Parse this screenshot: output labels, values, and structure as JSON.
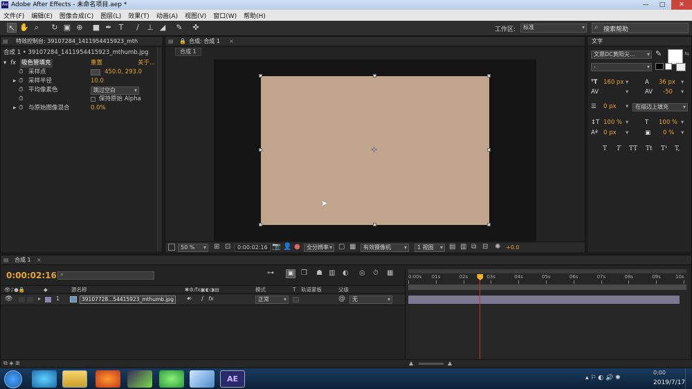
{
  "window": {
    "title": "Adobe After Effects - 未命名项目.aep *",
    "app_badge": "Ae",
    "controls": [
      "—",
      "□",
      "✕"
    ]
  },
  "menu": [
    "文件(F)",
    "编辑(E)",
    "图像合成(C)",
    "图层(L)",
    "效果(T)",
    "动画(A)",
    "视图(V)",
    "窗口(W)",
    "帮助(H)"
  ],
  "toolbar": {
    "workspace_label": "工作区:",
    "workspace_value": "标准",
    "search_placeholder": "搜索帮助"
  },
  "effects_panel": {
    "tab_label": "特效控制台: 39107284_1411954415923_mth",
    "breadcrumb": "合成 1 • 39107284_1411954415923_mthumb.jpg",
    "fx_badge": "fx",
    "effect_name": "吸色管填充",
    "reset": "重置",
    "about": "关于...",
    "props": [
      {
        "label": "采样点",
        "value": "450.0, 293.0"
      },
      {
        "label": "采样半径",
        "value": "10.0"
      },
      {
        "label": "平均像素色",
        "value": "跳过空白"
      },
      {
        "label": "保持原始 Alpha",
        "value": ""
      },
      {
        "label": "与原始图像混合",
        "value": "0.0%"
      }
    ]
  },
  "comp_panel": {
    "tab_label": "合成: 合成 1",
    "subtab": "合成 1",
    "layer_color": "#c0a48c",
    "bottom": {
      "zoom": "50 %",
      "timecode": "0:00:02:16",
      "resolution": "全分辨率",
      "camera": "有效摄像机",
      "views": "1 视图",
      "exposure": "+0.0"
    }
  },
  "character_panel": {
    "tab_label": "文字",
    "font": "文鼎DC黄阳尖...",
    "style": "-",
    "size": "160 px",
    "leading": "36 px",
    "kerning": "",
    "tracking": "-50",
    "stroke_width": "0 px",
    "stroke_mode": "在描边上填充",
    "vscale": "100 %",
    "hscale": "100 %",
    "baseline": "0 px",
    "tsume": "0 %",
    "styles": [
      "T",
      "T",
      "TT",
      "Tt",
      "T¹",
      "T,"
    ]
  },
  "timeline": {
    "tab_label": "合成 1",
    "timecode": "0:00:02:16",
    "headers": {
      "source_name": "源名称",
      "mode": "模式",
      "t": "T",
      "trkmat": "轨道蒙板",
      "parent": "父级"
    },
    "ruler": [
      "0:00s",
      "01s",
      "02s",
      "03s",
      "04s",
      "05s",
      "06s",
      "07s",
      "08s",
      "09s",
      "10s"
    ],
    "playhead_seconds": 2.6,
    "layer": {
      "index": "1",
      "name": "39107728...54415923_mthumb.jpg",
      "mode": "正常",
      "parent": "无"
    }
  },
  "taskbar": {
    "time": "0:00",
    "date": "2019/7/17",
    "ae_label": "AE"
  }
}
